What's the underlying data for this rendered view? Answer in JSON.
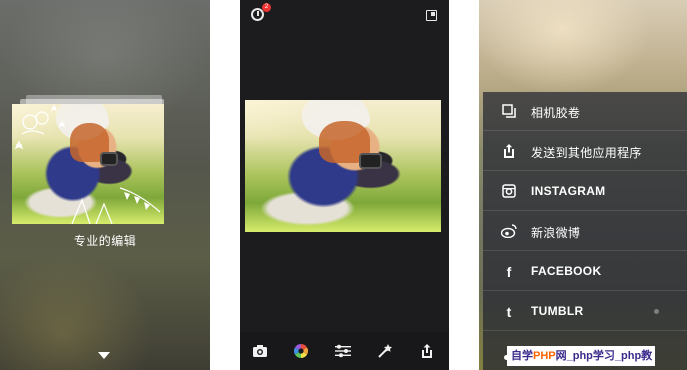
{
  "left_screen": {
    "caption": "专业的编辑"
  },
  "middle_screen": {
    "history_badge": "2",
    "toolbar": [
      "camera-icon",
      "color-wheel-icon",
      "adjust-sliders-icon",
      "magic-wand-icon",
      "share-icon"
    ]
  },
  "right_screen": {
    "share_menu": [
      {
        "icon": "gallery-icon",
        "label": "相机胶卷"
      },
      {
        "icon": "export-icon",
        "label": "发送到其他应用程序"
      },
      {
        "icon": "instagram-icon",
        "label": "INSTAGRAM"
      },
      {
        "icon": "weibo-icon",
        "label": "新浪微博"
      },
      {
        "icon": "facebook-icon",
        "label": "FACEBOOK"
      },
      {
        "icon": "tumblr-icon",
        "label": "TUMBLR"
      }
    ]
  },
  "watermark": {
    "text_a": "自学",
    "text_b": "PHP",
    "text_c": "网_php学习_php教"
  },
  "colors": {
    "editor_bg": "#1c1c1e",
    "sheet_bg": "rgba(35,38,48,0.72)",
    "badge": "#e33333"
  }
}
